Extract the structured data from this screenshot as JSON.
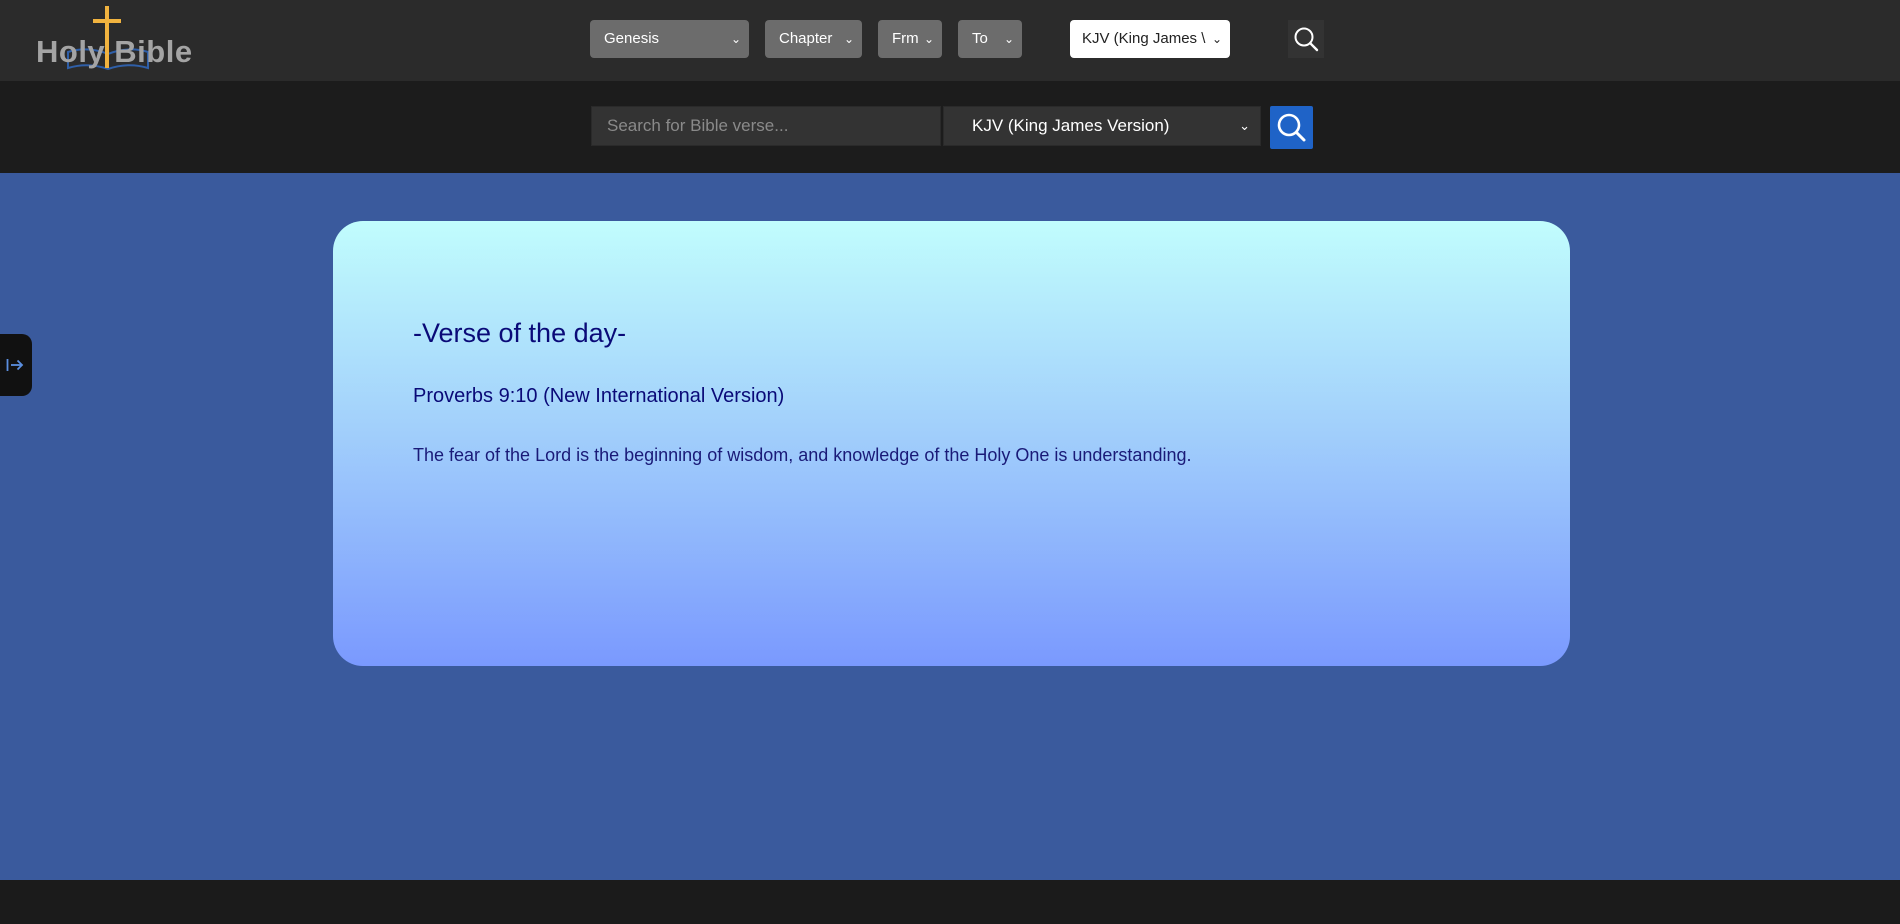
{
  "logo": {
    "text": "Holy Bible"
  },
  "nav": {
    "book_select": "Genesis",
    "chapter_select": "Chapter",
    "from_select": "Frm",
    "to_select": "To",
    "version_select": "KJV (King James \\"
  },
  "search": {
    "placeholder": "Search for Bible verse...",
    "version": "KJV (King James Version)"
  },
  "verse_card": {
    "title": "-Verse of the day-",
    "reference": "Proverbs 9:10 (New International Version)",
    "text": "The fear of the Lord is the beginning of wisdom, and knowledge of the Holy One is understanding."
  },
  "icons": [
    "search-icon",
    "expand-sidebar-icon",
    "chevron-down-icon",
    "cross-icon",
    "book-icon"
  ],
  "colors": {
    "topbar": "#2b2b2b",
    "searchbar": "#1c1c1c",
    "main_background": "#3a5a9d",
    "search_button": "#1f63c7",
    "card_gradient_top": "#c1fdfd",
    "card_gradient_bottom": "#7a99fe",
    "card_text": "#0a0a78",
    "logo_cross": "#f1b33f"
  }
}
